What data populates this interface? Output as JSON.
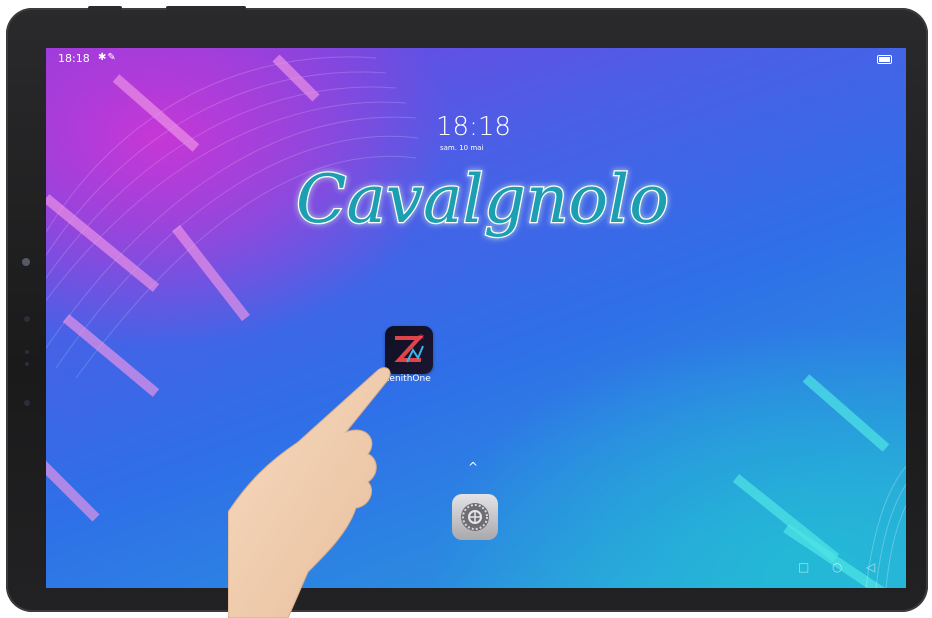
{
  "status_bar": {
    "time": "18:18",
    "icons": [
      "notification-icon",
      "notification-icon"
    ],
    "battery_icon": "battery-icon"
  },
  "lockscreen": {
    "clock": "18:18",
    "date": "sam. 10 mai"
  },
  "wallpaper_brand": {
    "text": "Cavalgnolo"
  },
  "home": {
    "apps": [
      {
        "label": "ZenithOne",
        "icon": "zenithone-app-icon"
      }
    ],
    "dock": [
      {
        "icon": "settings-icon"
      }
    ],
    "drawer_hint_icon": "chevron-up-icon"
  },
  "nav_bar": {
    "recent_icon": "square-icon",
    "home_icon": "circle-icon",
    "back_icon": "triangle-back-icon"
  },
  "colors": {
    "wallpaper_top_left": "#c637d6",
    "wallpaper_mid": "#2f6fe8",
    "wallpaper_bottom_right": "#31b2dc",
    "brand_text": "#1f9fb1"
  }
}
